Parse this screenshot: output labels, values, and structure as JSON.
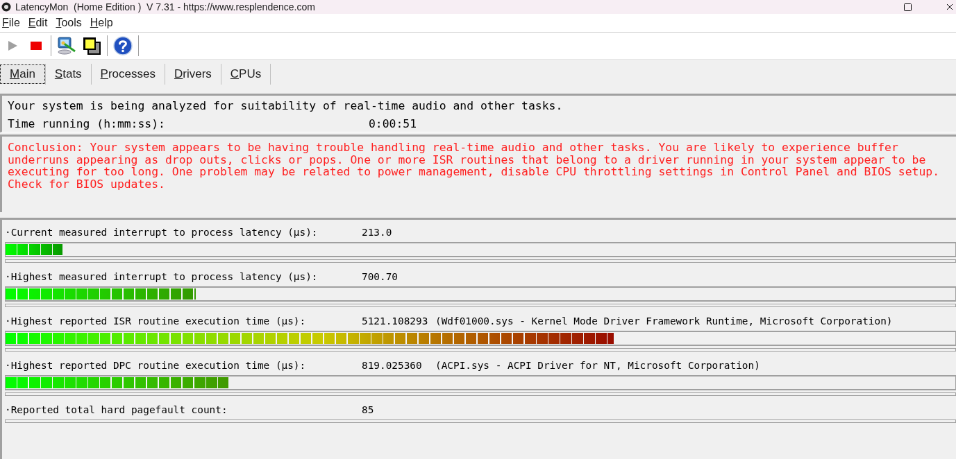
{
  "window": {
    "title": "LatencyMon  (Home Edition )  V 7.31 - https://www.resplendence.com"
  },
  "menu": [
    "File",
    "Edit",
    "Tools",
    "Help"
  ],
  "toolbar": [
    {
      "kind": "play",
      "disabled": true
    },
    {
      "kind": "stop",
      "disabled": false
    },
    {
      "kind": "separator"
    },
    {
      "kind": "monitor",
      "disabled": false
    },
    {
      "kind": "windows",
      "disabled": false
    },
    {
      "kind": "separator"
    },
    {
      "kind": "help",
      "disabled": false
    },
    {
      "kind": "separator"
    }
  ],
  "tabs": [
    {
      "label": "Main",
      "selected": true
    },
    {
      "label": "Stats",
      "selected": false
    },
    {
      "label": "Processes",
      "selected": false
    },
    {
      "label": "Drivers",
      "selected": false
    },
    {
      "label": "CPUs",
      "selected": false
    }
  ],
  "status": {
    "message": "Your system is being analyzed for suitability of real-time audio and other tasks.",
    "time_label": "Time running (h:mm:ss):",
    "time_value": "0:00:51"
  },
  "conclusion": "Conclusion: Your system appears to be having trouble handling real-time audio and other tasks. You are likely to experience buffer underruns appearing as drop outs, clicks or pops. One or more ISR routines that belong to a driver running in your system appear to be executing for too long. One problem may be related to power management, disable CPU throttling settings in Control Panel and BIOS setup. Check for BIOS updates.",
  "measurements": [
    {
      "label": "·Current measured interrupt to process latency (µs):",
      "value": "213.0",
      "level": 0.06
    },
    {
      "label": "·Highest measured interrupt to process latency (µs):",
      "value": "700.70",
      "level": 0.2
    },
    {
      "label": "·Highest reported ISR routine execution time (µs):",
      "value": "5121.108293",
      "detail": "(Wdf01000.sys - Kernel Mode Driver Framework Runtime, Microsoft Corporation)",
      "level": 0.64
    },
    {
      "label": "·Highest reported DPC routine execution time (µs):",
      "value": "819.025360",
      "detail": "(ACPI.sys - ACPI Driver for NT, Microsoft Corporation)",
      "level": 0.235
    },
    {
      "label": "·Reported total hard pagefault count:",
      "value": "85"
    }
  ]
}
